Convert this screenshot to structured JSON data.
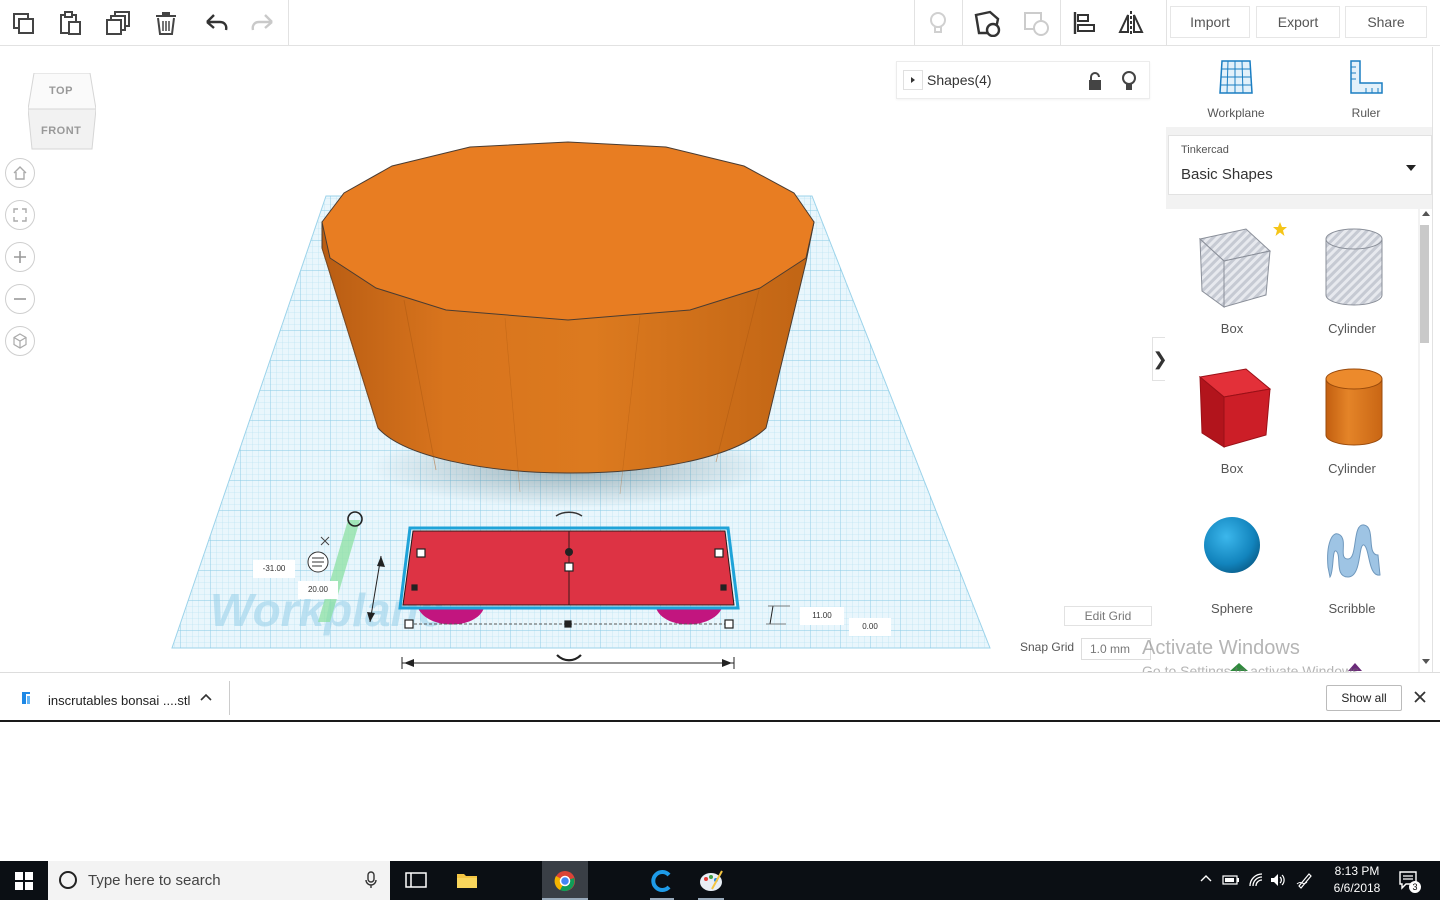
{
  "toolbar": {
    "buttons": [
      "copy-icon",
      "paste-icon",
      "duplicate-icon",
      "delete-icon",
      "undo-icon",
      "redo-icon",
      "lightbulb-icon",
      "group-icon",
      "ungroup-icon",
      "align-icon",
      "mirror-icon"
    ],
    "import_label": "Import",
    "export_label": "Export",
    "share_label": "Share"
  },
  "viewcube": {
    "top_label": "TOP",
    "front_label": "FRONT"
  },
  "nav_buttons": [
    "home-icon",
    "fit-view-icon",
    "zoom-in-icon",
    "zoom-out-icon",
    "perspective-icon"
  ],
  "shapes_panel": {
    "title": "Shapes(4)"
  },
  "workplane": {
    "watermark": "Workplane"
  },
  "dimensions": {
    "x_pos": "-31.00",
    "y_size": "20.00",
    "z_height": "11.00",
    "z_elev": "0.00"
  },
  "grid_controls": {
    "edit_grid_label": "Edit Grid",
    "snap_grid_label": "Snap Grid",
    "snap_grid_value": "1.0 mm"
  },
  "sidebar": {
    "tools": [
      {
        "label": "Workplane",
        "icon": "workplane-icon"
      },
      {
        "label": "Ruler",
        "icon": "ruler-icon"
      }
    ],
    "library": {
      "provider": "Tinkercad",
      "name": "Basic Shapes"
    },
    "shapes": [
      {
        "name": "Box",
        "color": "#b0b6c2",
        "kind": "box-hole"
      },
      {
        "name": "Cylinder",
        "color": "#b0b6c2",
        "kind": "cylinder-hole"
      },
      {
        "name": "Box",
        "color": "#d0202a",
        "kind": "box"
      },
      {
        "name": "Cylinder",
        "color": "#e07a1a",
        "kind": "cylinder"
      },
      {
        "name": "Sphere",
        "color": "#1a90c8",
        "kind": "sphere"
      },
      {
        "name": "Scribble",
        "color": "#8fb6da",
        "kind": "scribble"
      }
    ]
  },
  "watermark": {
    "line1": "Activate Windows",
    "line2": "Go to Settings to activate Windows."
  },
  "download_bar": {
    "file_name": "inscrutables bonsai ....stl",
    "show_all_label": "Show all"
  },
  "taskbar": {
    "search_placeholder": "Type here to search",
    "time": "8:13 PM",
    "date": "6/6/2018",
    "notifications": "3"
  },
  "colors": {
    "orange": "#e87d22",
    "red": "#dd3344",
    "magenta": "#c2157f",
    "grid": "#a9dcef",
    "accent": "#1ea3d8"
  }
}
